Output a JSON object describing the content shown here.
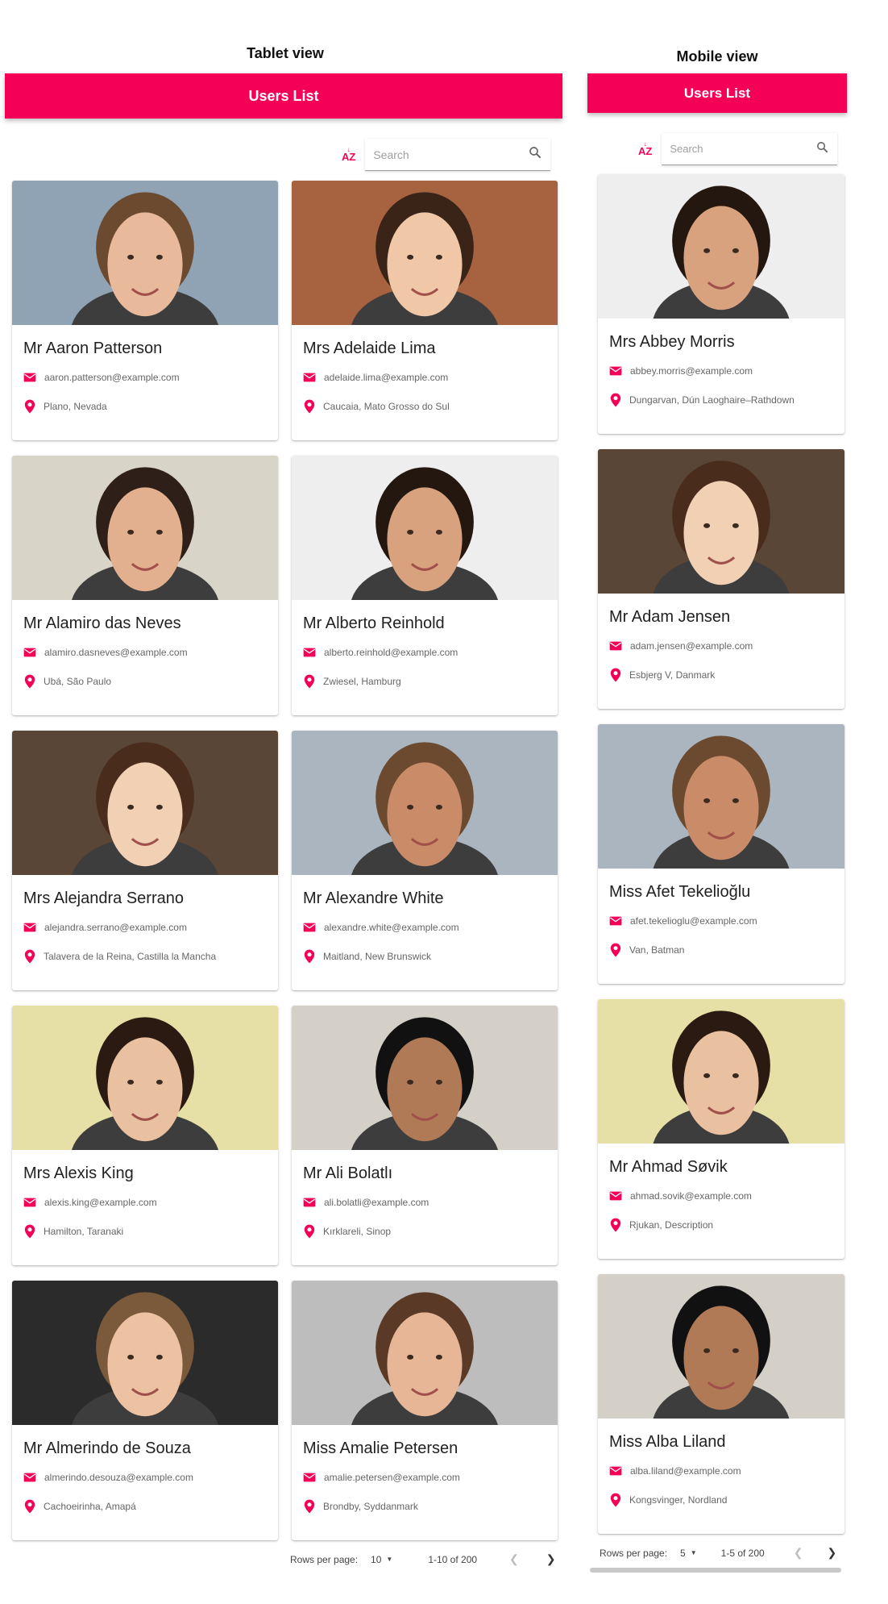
{
  "tablet": {
    "label": "Tablet view",
    "app_title": "Users List",
    "sort_icon_text": "AZ",
    "search_placeholder": "Search",
    "users": [
      {
        "name": "Mr Aaron Patterson",
        "email": "aaron.patterson@example.com",
        "location": "Plano, Nevada"
      },
      {
        "name": "Mrs Adelaide Lima",
        "email": "adelaide.lima@example.com",
        "location": "Caucaia, Mato Grosso do Sul"
      },
      {
        "name": "Mr Alamiro das Neves",
        "email": "alamiro.dasneves@example.com",
        "location": "Ubá, São Paulo"
      },
      {
        "name": "Mr Alberto Reinhold",
        "email": "alberto.reinhold@example.com",
        "location": "Zwiesel, Hamburg"
      },
      {
        "name": "Mrs Alejandra Serrano",
        "email": "alejandra.serrano@example.com",
        "location": "Talavera de la Reina, Castilla la Mancha"
      },
      {
        "name": "Mr Alexandre White",
        "email": "alexandre.white@example.com",
        "location": "Maitland, New Brunswick"
      },
      {
        "name": "Mrs Alexis King",
        "email": "alexis.king@example.com",
        "location": "Hamilton, Taranaki"
      },
      {
        "name": "Mr Ali Bolatlı",
        "email": "ali.bolatli@example.com",
        "location": "Kırklareli, Sinop"
      },
      {
        "name": "Mr Almerindo de Souza",
        "email": "almerindo.desouza@example.com",
        "location": "Cachoeirinha, Amapá"
      },
      {
        "name": "Miss Amalie Petersen",
        "email": "amalie.petersen@example.com",
        "location": "Brondby, Syddanmark"
      }
    ],
    "pagination": {
      "rows_label": "Rows per page:",
      "rows_value": "10",
      "range": "1-10 of 200"
    }
  },
  "mobile": {
    "label": "Mobile view",
    "app_title": "Users List",
    "sort_icon_text": "AZ",
    "search_placeholder": "Search",
    "users": [
      {
        "name": "Mrs Abbey Morris",
        "email": "abbey.morris@example.com",
        "location": "Dungarvan, Dún Laoghaire–Rathdown"
      },
      {
        "name": "Mr Adam Jensen",
        "email": "adam.jensen@example.com",
        "location": "Esbjerg V, Danmark"
      },
      {
        "name": "Miss Afet Tekelioğlu",
        "email": "afet.tekelioglu@example.com",
        "location": "Van, Batman"
      },
      {
        "name": "Mr Ahmad Søvik",
        "email": "ahmad.sovik@example.com",
        "location": "Rjukan, Description"
      },
      {
        "name": "Miss Alba Liland",
        "email": "alba.liland@example.com",
        "location": "Kongsvinger, Nordland"
      }
    ],
    "pagination": {
      "rows_label": "Rows per page:",
      "rows_value": "5",
      "range": "1-5 of 200"
    }
  },
  "colors": {
    "accent": "#f50057",
    "text": "#212121",
    "muted": "#666666"
  },
  "icons": {
    "sort": "sort-az-icon",
    "search": "search-icon",
    "email": "email-icon",
    "location": "location-pin-icon",
    "prev": "chevron-left-icon",
    "next": "chevron-right-icon",
    "dropdown": "caret-down-icon"
  }
}
